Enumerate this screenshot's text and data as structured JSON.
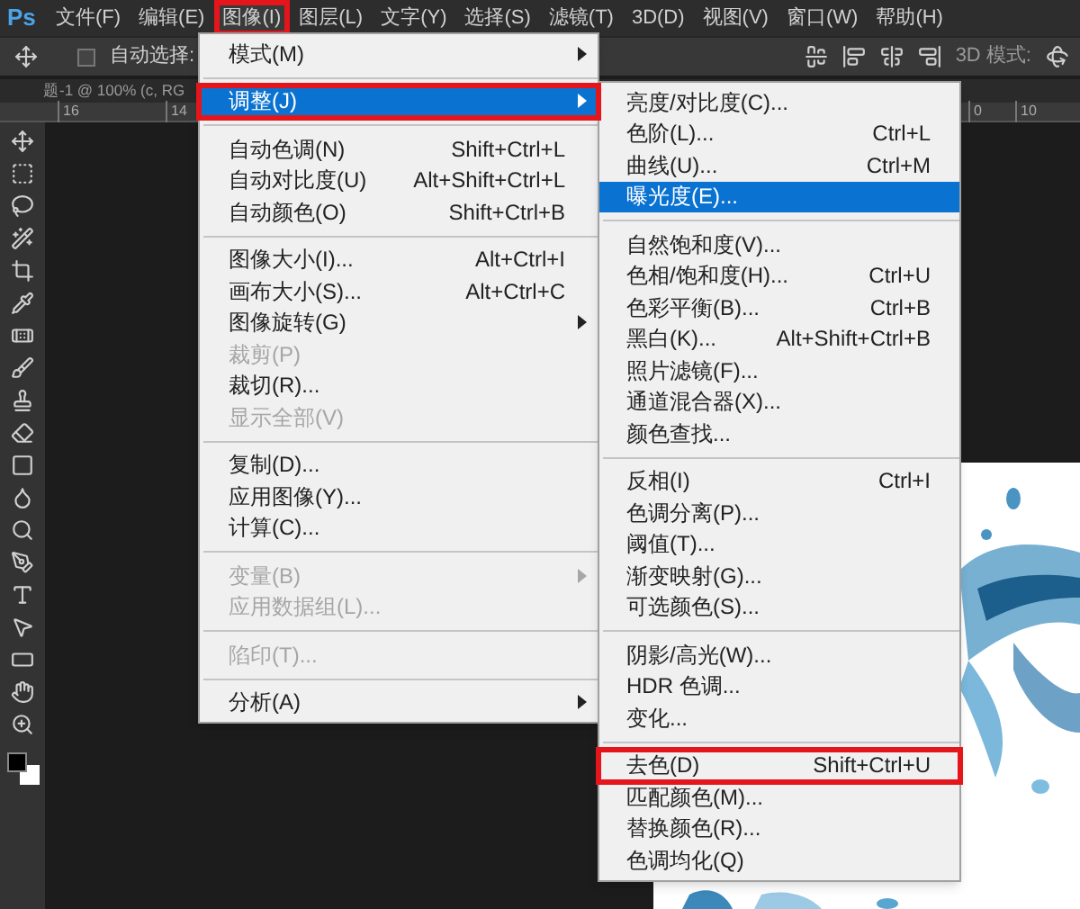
{
  "app_logo": "Ps",
  "menubar": [
    {
      "label": "文件(F)",
      "marked": false
    },
    {
      "label": "编辑(E)",
      "marked": false
    },
    {
      "label": "图像(I)",
      "marked": true
    },
    {
      "label": "图层(L)",
      "marked": false
    },
    {
      "label": "文字(Y)",
      "marked": false
    },
    {
      "label": "选择(S)",
      "marked": false
    },
    {
      "label": "滤镜(T)",
      "marked": false
    },
    {
      "label": "3D(D)",
      "marked": false
    },
    {
      "label": "视图(V)",
      "marked": false
    },
    {
      "label": "窗口(W)",
      "marked": false
    },
    {
      "label": "帮助(H)",
      "marked": false
    }
  ],
  "options_bar": {
    "auto_select": {
      "label": "自动选择:",
      "checked": false
    },
    "mode_3d_label": "3D 模式:"
  },
  "document_tab": {
    "title": "题-1 @ 100% (c, RG"
  },
  "ruler": {
    "left_ticks": [
      "16",
      "14"
    ],
    "right_ticks": [
      "0",
      "10"
    ]
  },
  "image_menu": [
    {
      "kind": "item",
      "label": "模式(M)",
      "submenu": true,
      "disabled": false,
      "selected": false,
      "marked": false
    },
    {
      "kind": "separator"
    },
    {
      "kind": "item",
      "label": "调整(J)",
      "submenu": true,
      "disabled": false,
      "selected": true,
      "marked": true
    },
    {
      "kind": "separator"
    },
    {
      "kind": "item",
      "label": "自动色调(N)",
      "shortcut": "Shift+Ctrl+L",
      "submenu": false,
      "disabled": false,
      "selected": false,
      "marked": false
    },
    {
      "kind": "item",
      "label": "自动对比度(U)",
      "shortcut": "Alt+Shift+Ctrl+L",
      "submenu": false,
      "disabled": false,
      "selected": false,
      "marked": false
    },
    {
      "kind": "item",
      "label": "自动颜色(O)",
      "shortcut": "Shift+Ctrl+B",
      "submenu": false,
      "disabled": false,
      "selected": false,
      "marked": false
    },
    {
      "kind": "separator"
    },
    {
      "kind": "item",
      "label": "图像大小(I)...",
      "shortcut": "Alt+Ctrl+I",
      "submenu": false,
      "disabled": false,
      "selected": false,
      "marked": false
    },
    {
      "kind": "item",
      "label": "画布大小(S)...",
      "shortcut": "Alt+Ctrl+C",
      "submenu": false,
      "disabled": false,
      "selected": false,
      "marked": false
    },
    {
      "kind": "item",
      "label": "图像旋转(G)",
      "submenu": true,
      "disabled": false,
      "selected": false,
      "marked": false
    },
    {
      "kind": "item",
      "label": "裁剪(P)",
      "submenu": false,
      "disabled": true,
      "selected": false,
      "marked": false
    },
    {
      "kind": "item",
      "label": "裁切(R)...",
      "submenu": false,
      "disabled": false,
      "selected": false,
      "marked": false
    },
    {
      "kind": "item",
      "label": "显示全部(V)",
      "submenu": false,
      "disabled": true,
      "selected": false,
      "marked": false
    },
    {
      "kind": "separator"
    },
    {
      "kind": "item",
      "label": "复制(D)...",
      "submenu": false,
      "disabled": false,
      "selected": false,
      "marked": false
    },
    {
      "kind": "item",
      "label": "应用图像(Y)...",
      "submenu": false,
      "disabled": false,
      "selected": false,
      "marked": false
    },
    {
      "kind": "item",
      "label": "计算(C)...",
      "submenu": false,
      "disabled": false,
      "selected": false,
      "marked": false
    },
    {
      "kind": "separator"
    },
    {
      "kind": "item",
      "label": "变量(B)",
      "submenu": true,
      "disabled": true,
      "selected": false,
      "marked": false
    },
    {
      "kind": "item",
      "label": "应用数据组(L)...",
      "submenu": false,
      "disabled": true,
      "selected": false,
      "marked": false
    },
    {
      "kind": "separator"
    },
    {
      "kind": "item",
      "label": "陷印(T)...",
      "submenu": false,
      "disabled": true,
      "selected": false,
      "marked": false
    },
    {
      "kind": "separator"
    },
    {
      "kind": "item",
      "label": "分析(A)",
      "submenu": true,
      "disabled": false,
      "selected": false,
      "marked": false
    }
  ],
  "adjustments_menu": [
    {
      "kind": "item",
      "label": "亮度/对比度(C)...",
      "submenu": false,
      "disabled": false,
      "selected": false,
      "marked": false
    },
    {
      "kind": "item",
      "label": "色阶(L)...",
      "shortcut": "Ctrl+L",
      "submenu": false,
      "disabled": false,
      "selected": false,
      "marked": false
    },
    {
      "kind": "item",
      "label": "曲线(U)...",
      "shortcut": "Ctrl+M",
      "submenu": false,
      "disabled": false,
      "selected": false,
      "marked": false
    },
    {
      "kind": "item",
      "label": "曝光度(E)...",
      "submenu": false,
      "disabled": false,
      "selected": true,
      "marked": false
    },
    {
      "kind": "separator"
    },
    {
      "kind": "item",
      "label": "自然饱和度(V)...",
      "submenu": false,
      "disabled": false,
      "selected": false,
      "marked": false
    },
    {
      "kind": "item",
      "label": "色相/饱和度(H)...",
      "shortcut": "Ctrl+U",
      "submenu": false,
      "disabled": false,
      "selected": false,
      "marked": false
    },
    {
      "kind": "item",
      "label": "色彩平衡(B)...",
      "shortcut": "Ctrl+B",
      "submenu": false,
      "disabled": false,
      "selected": false,
      "marked": false
    },
    {
      "kind": "item",
      "label": "黑白(K)...",
      "shortcut": "Alt+Shift+Ctrl+B",
      "submenu": false,
      "disabled": false,
      "selected": false,
      "marked": false
    },
    {
      "kind": "item",
      "label": "照片滤镜(F)...",
      "submenu": false,
      "disabled": false,
      "selected": false,
      "marked": false
    },
    {
      "kind": "item",
      "label": "通道混合器(X)...",
      "submenu": false,
      "disabled": false,
      "selected": false,
      "marked": false
    },
    {
      "kind": "item",
      "label": "颜色查找...",
      "submenu": false,
      "disabled": false,
      "selected": false,
      "marked": false
    },
    {
      "kind": "separator"
    },
    {
      "kind": "item",
      "label": "反相(I)",
      "shortcut": "Ctrl+I",
      "submenu": false,
      "disabled": false,
      "selected": false,
      "marked": false
    },
    {
      "kind": "item",
      "label": "色调分离(P)...",
      "submenu": false,
      "disabled": false,
      "selected": false,
      "marked": false
    },
    {
      "kind": "item",
      "label": "阈值(T)...",
      "submenu": false,
      "disabled": false,
      "selected": false,
      "marked": false
    },
    {
      "kind": "item",
      "label": "渐变映射(G)...",
      "submenu": false,
      "disabled": false,
      "selected": false,
      "marked": false
    },
    {
      "kind": "item",
      "label": "可选颜色(S)...",
      "submenu": false,
      "disabled": false,
      "selected": false,
      "marked": false
    },
    {
      "kind": "separator"
    },
    {
      "kind": "item",
      "label": "阴影/高光(W)...",
      "submenu": false,
      "disabled": false,
      "selected": false,
      "marked": false
    },
    {
      "kind": "item",
      "label": "HDR 色调...",
      "submenu": false,
      "disabled": false,
      "selected": false,
      "marked": false
    },
    {
      "kind": "item",
      "label": "变化...",
      "submenu": false,
      "disabled": false,
      "selected": false,
      "marked": false
    },
    {
      "kind": "separator"
    },
    {
      "kind": "item",
      "label": "去色(D)",
      "shortcut": "Shift+Ctrl+U",
      "submenu": false,
      "disabled": false,
      "selected": false,
      "marked": true
    },
    {
      "kind": "item",
      "label": "匹配颜色(M)...",
      "submenu": false,
      "disabled": false,
      "selected": false,
      "marked": false
    },
    {
      "kind": "item",
      "label": "替换颜色(R)...",
      "submenu": false,
      "disabled": false,
      "selected": false,
      "marked": false
    },
    {
      "kind": "item",
      "label": "色调均化(Q)",
      "submenu": false,
      "disabled": false,
      "selected": false,
      "marked": false
    }
  ]
}
